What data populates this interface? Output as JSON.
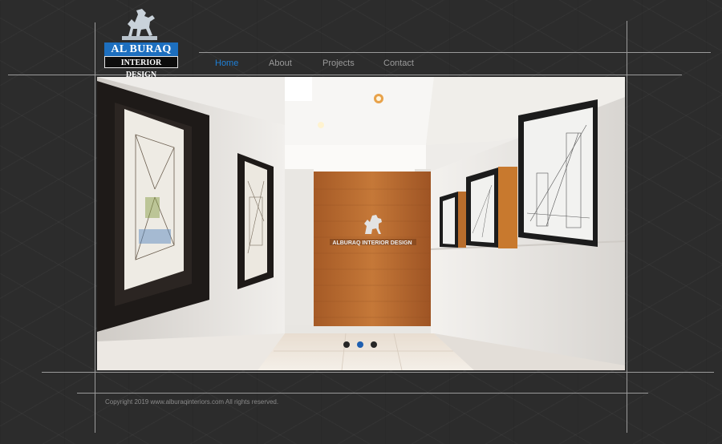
{
  "brand": {
    "line1": "AL BURAQ",
    "line2": "INTERIOR DESIGN",
    "wall_sign": "ALBURAQ INTERIOR DESIGN",
    "logo_icon": "horse-icon",
    "blue": "#1d6fbf"
  },
  "nav": {
    "items": [
      {
        "label": "Home",
        "active": true
      },
      {
        "label": "About",
        "active": false
      },
      {
        "label": "Projects",
        "active": false
      },
      {
        "label": "Contact",
        "active": false
      }
    ],
    "active_color": "#1e7fd6",
    "text_color": "#9a9a9a"
  },
  "slider": {
    "slide_count": 3,
    "active_slide": 2
  },
  "footer": {
    "copyright": "Copyright 2019 www.alburaqinteriors.com All rights reserved."
  }
}
